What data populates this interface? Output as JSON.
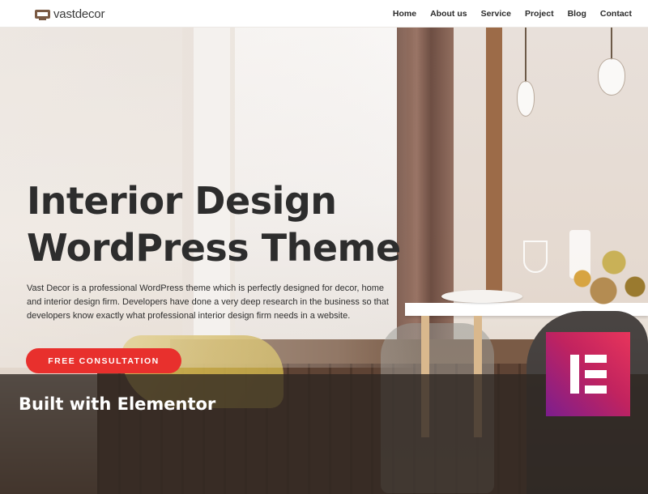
{
  "header": {
    "logo_text_light": "vast",
    "logo_text_bold": "decor",
    "nav": [
      "Home",
      "About us",
      "Service",
      "Project",
      "Blog",
      "Contact"
    ]
  },
  "hero": {
    "title_line1": "Interior Design",
    "title_line2": "WordPress Theme",
    "description": "Vast Decor is a professional WordPress theme which is perfectly designed for decor, home and interior design firm. Developers have done a very deep research in the business so that developers know exactly what professional interior design firm needs in a website.",
    "cta_label": "FREE CONSULTATION"
  },
  "banner": {
    "text": "Built with Elementor",
    "badge_icon": "elementor-icon"
  },
  "colors": {
    "accent": "#e8302d",
    "logo": "#7a5a44",
    "banner_overlay": "#2e2621",
    "badge_gradient_start": "#7c1e8e",
    "badge_gradient_end": "#e8355b"
  }
}
